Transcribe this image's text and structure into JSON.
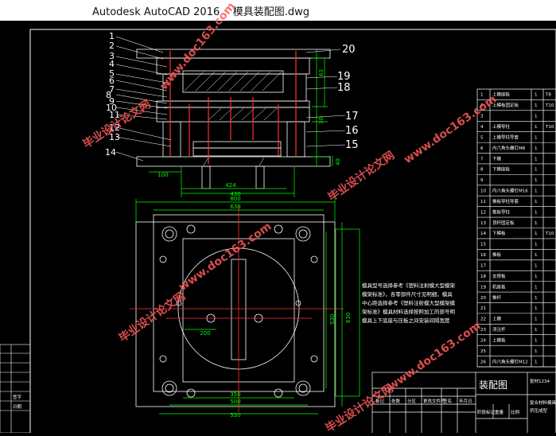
{
  "window": {
    "app": "Autodesk AutoCAD 2016",
    "file": "模具装配图.dwg"
  },
  "callouts": {
    "left": [
      "1",
      "2",
      "3",
      "4",
      "5",
      "6",
      "7",
      "8",
      "9",
      "10",
      "11",
      "12",
      "13",
      "14"
    ],
    "right": [
      "20",
      "19",
      "18",
      "17",
      "16",
      "15"
    ]
  },
  "dims": {
    "width_424": "424",
    "width_430": "430",
    "left_100": "100",
    "h_63": "63",
    "h_30": "30",
    "h_40": "40",
    "top_800": "800",
    "top_630": "630",
    "bot_350": "350",
    "bot_500": "500",
    "bot_530": "530",
    "right_530": "530",
    "right_630": "630",
    "mid_200": "200"
  },
  "notes": [
    "模具型号选择参考《塑料注射模大型模架",
    "模架标准》，各零部件尺寸见明细，模具",
    "中心距选择参考《塑料注射模大型模架模",
    "架标准》模具材料选择按照加工的部号明",
    "模具上下底座与压板之间安装间隔宽度"
  ],
  "bom": {
    "rows": [
      {
        "no": "1",
        "name": "上模座板",
        "qty": "1"
      },
      {
        "no": "2",
        "name": "上模板固定板",
        "qty": "1"
      },
      {
        "no": "3",
        "name": "",
        "qty": "1"
      },
      {
        "no": "4",
        "name": "上模导柱",
        "qty": "1"
      },
      {
        "no": "5",
        "name": "上模导柱导套",
        "qty": "1"
      },
      {
        "no": "6",
        "name": "内六角头螺钉M8",
        "qty": "1"
      },
      {
        "no": "7",
        "name": "下模",
        "qty": "1"
      },
      {
        "no": "8",
        "name": "下模座板",
        "qty": "1"
      },
      {
        "no": "9",
        "name": "",
        "qty": "1"
      },
      {
        "no": "10",
        "name": "内六角头螺钉M16",
        "qty": "1"
      },
      {
        "no": "11",
        "name": "推板导柱导套",
        "qty": "1"
      },
      {
        "no": "12",
        "name": "推板导柱",
        "qty": "1"
      },
      {
        "no": "13",
        "name": "顶杆固定板",
        "qty": "1"
      },
      {
        "no": "14",
        "name": "下模板",
        "qty": "1"
      },
      {
        "no": "15",
        "name": "",
        "qty": "1"
      },
      {
        "no": "16",
        "name": "推板",
        "qty": "1"
      },
      {
        "no": "17",
        "name": "",
        "qty": "1"
      },
      {
        "no": "18",
        "name": "支撑板",
        "qty": "1"
      },
      {
        "no": "19",
        "name": "机座板",
        "qty": "1"
      },
      {
        "no": "20",
        "name": "推杆",
        "qty": "1"
      },
      {
        "no": "21",
        "name": "",
        "qty": "1"
      },
      {
        "no": "22",
        "name": "上模",
        "qty": "1"
      },
      {
        "no": "23",
        "name": "浇注杆",
        "qty": "1"
      },
      {
        "no": "24",
        "name": "上模板",
        "qty": "1"
      },
      {
        "no": "25",
        "name": "",
        "qty": "1"
      },
      {
        "no": "26",
        "name": "内六角头螺钉M12",
        "qty": "1"
      }
    ],
    "right_codes": [
      "T8",
      "T10",
      "",
      "T10",
      "",
      "",
      "",
      "",
      "",
      "",
      "",
      "",
      "",
      "T10",
      "",
      "",
      "",
      "",
      "",
      "",
      "",
      "",
      "",
      "",
      "",
      ""
    ]
  },
  "title_block": {
    "drawing_name": "装配图",
    "company": "复合材料模具",
    "right_label": "复材1234",
    "bottom_label": "挤压成型",
    "header_cells": [
      "标记",
      "处数",
      "分区",
      "更改文件号",
      "签名",
      "年月日"
    ],
    "footer_cells": [
      "阶段标记",
      "重量",
      "比例"
    ]
  },
  "left_block": [
    "",
    "",
    "",
    "",
    "",
    "签字",
    "日期"
  ],
  "watermarks": {
    "text_cn": "毕业设计论文网",
    "text_url": "www.doc163.com"
  },
  "colors": {
    "background": "#000000",
    "line_white": "#ffffff",
    "line_green": "#00ff00",
    "line_red": "#ff3030",
    "watermark": "#ff5a5a",
    "dim_text": "#00ff00"
  }
}
